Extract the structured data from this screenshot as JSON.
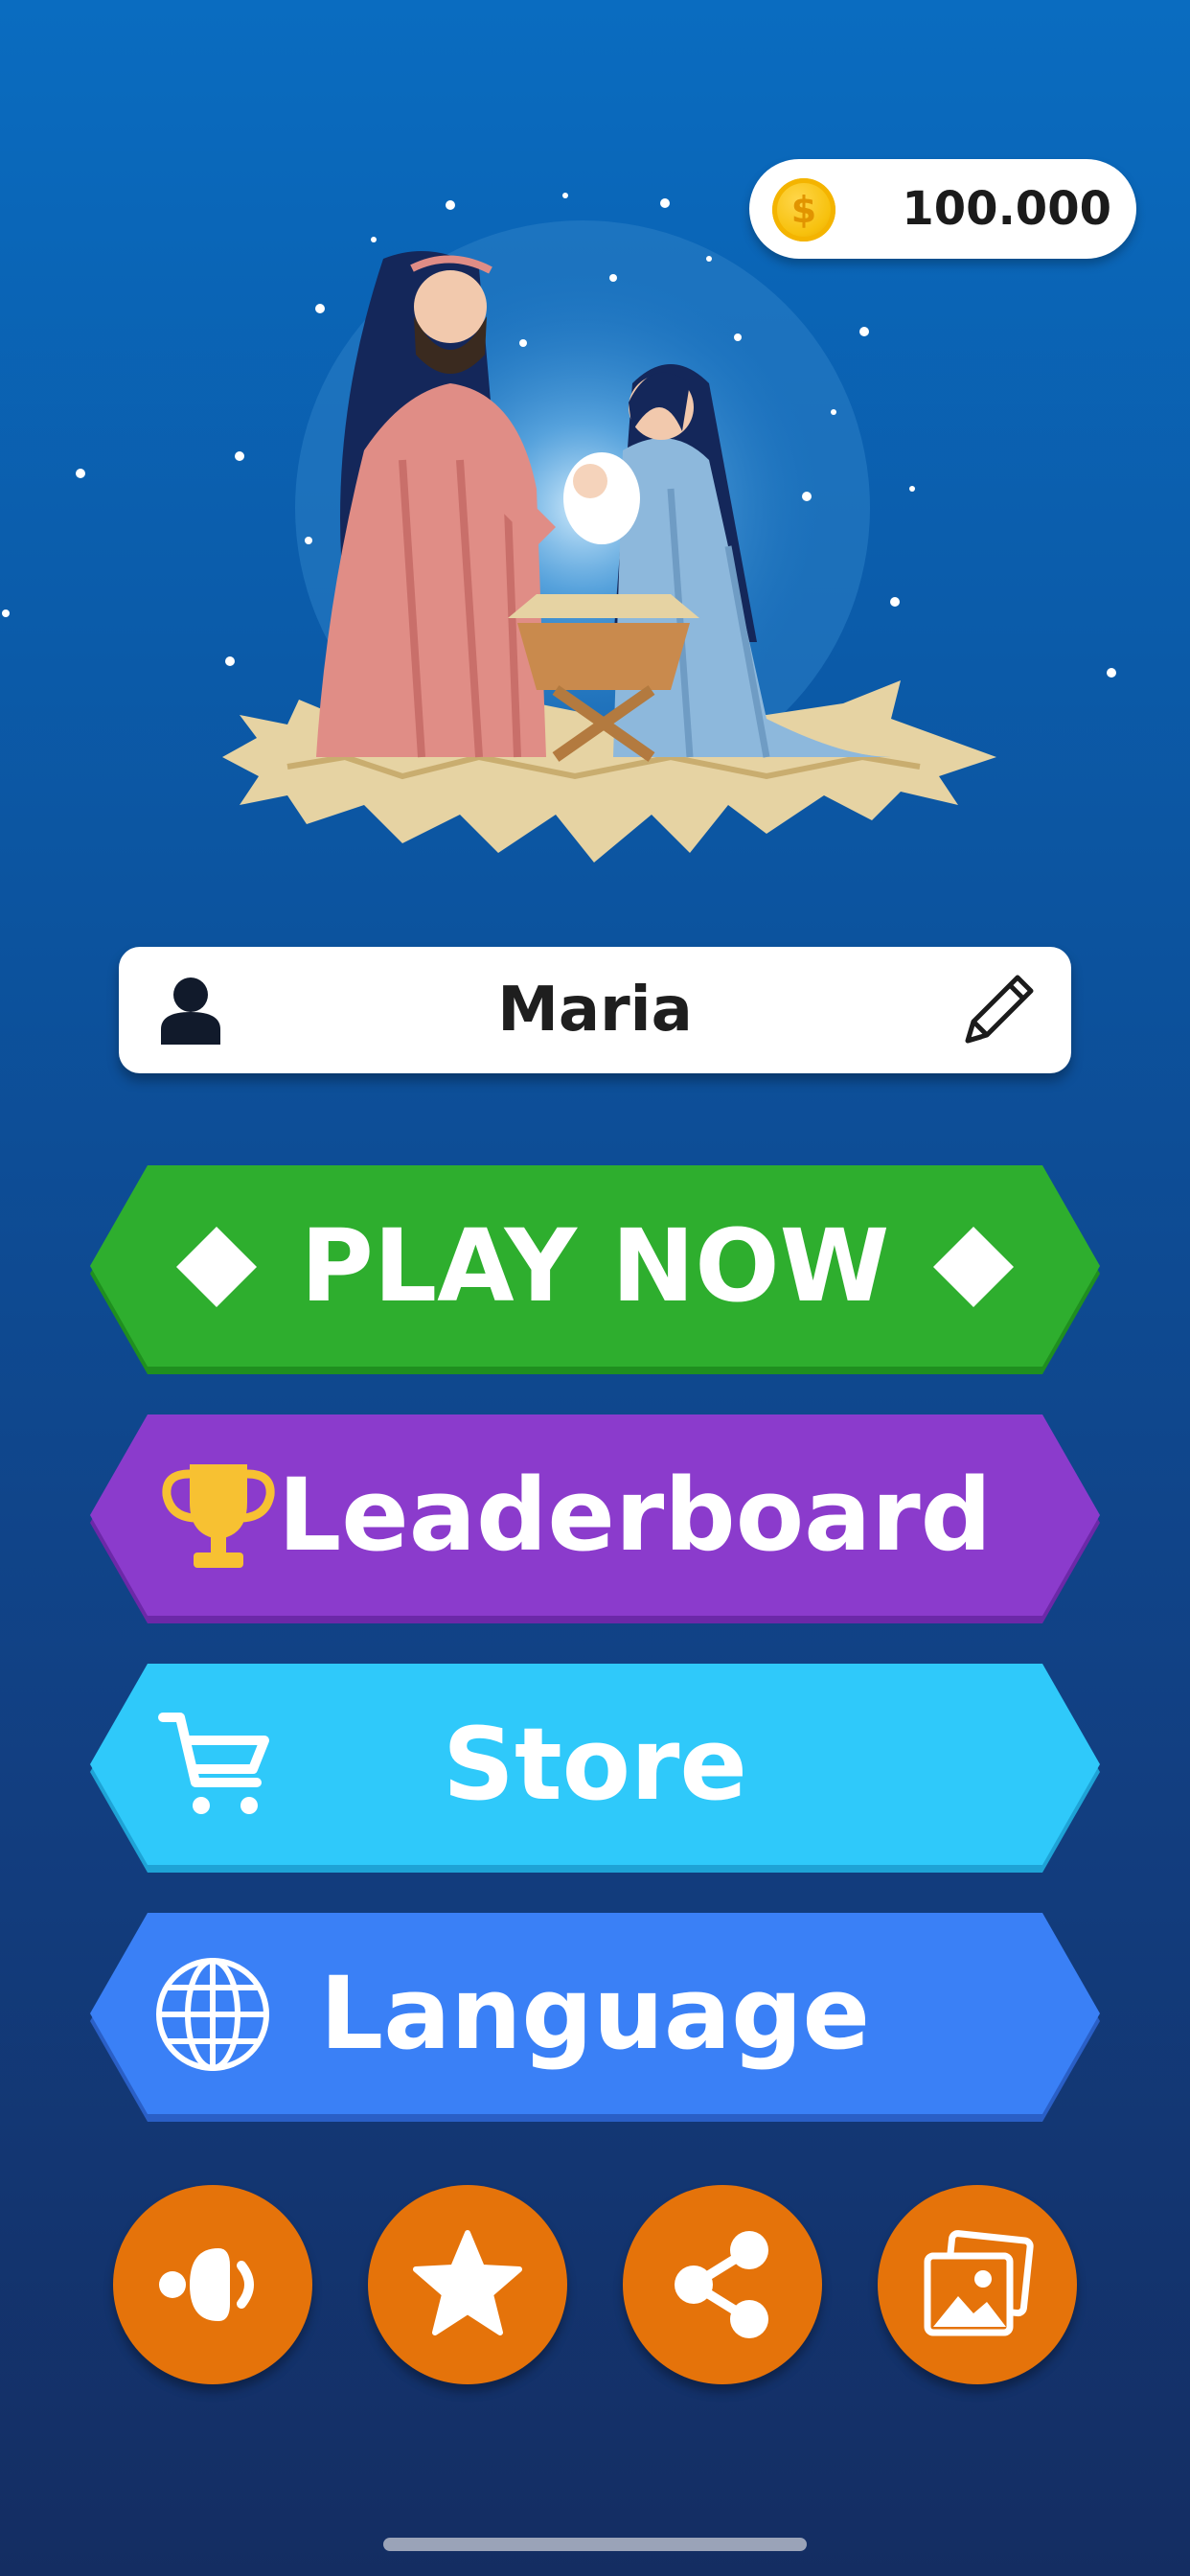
{
  "coins": {
    "value": "100.000",
    "coin_symbol": "$",
    "icon": "coin-icon"
  },
  "player": {
    "name": "Maria",
    "user_icon": "user-icon",
    "edit_icon": "pencil-icon"
  },
  "menu": {
    "play_label": "PLAY NOW",
    "leaderboard_label": "Leaderboard",
    "store_label": "Store",
    "language_label": "Language"
  },
  "colors": {
    "play": "#2eae2e",
    "leaderboard": "#8b3bcc",
    "store": "#2fc9fa",
    "language": "#3a80f6",
    "round_buttons": "#e5730a"
  },
  "bottom_icons": [
    "sound-icon",
    "star-icon",
    "share-icon",
    "gallery-icon"
  ]
}
